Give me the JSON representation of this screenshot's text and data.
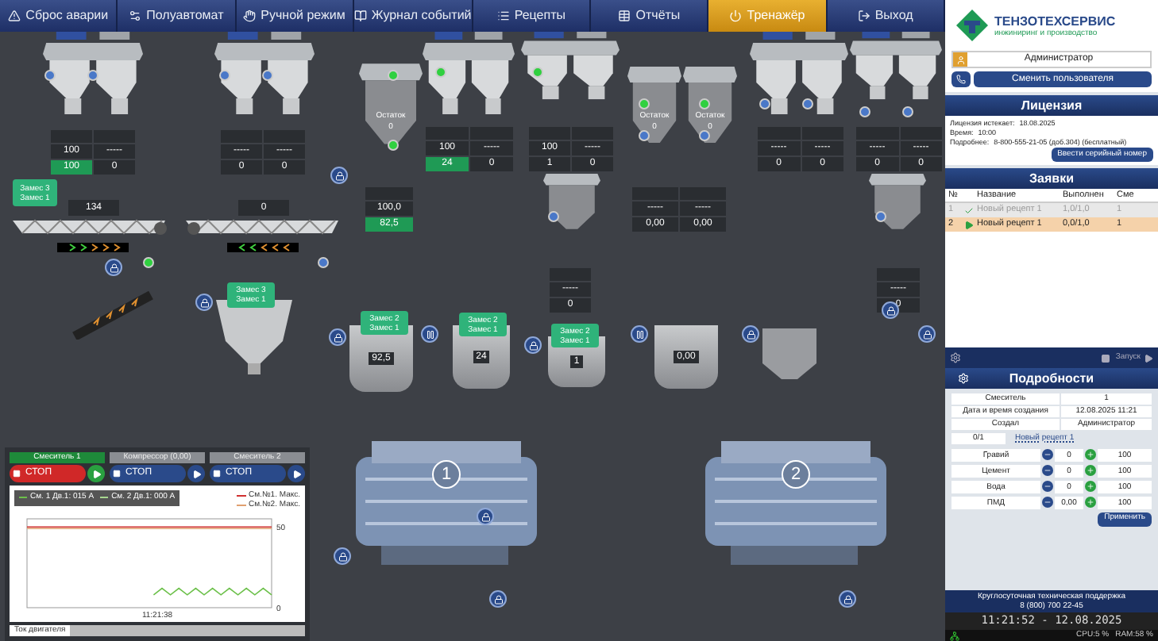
{
  "menu": [
    {
      "label": "Сброс аварии",
      "selected": false
    },
    {
      "label": "Полуавтомат",
      "selected": false
    },
    {
      "label": "Ручной режим",
      "selected": false
    },
    {
      "label": "Журнал событий",
      "selected": false
    },
    {
      "label": "Рецепты",
      "selected": false
    },
    {
      "label": "Отчёты",
      "selected": false
    },
    {
      "label": "Тренажёр",
      "selected": true
    },
    {
      "label": "Выход",
      "selected": false
    }
  ],
  "canvas": {
    "readouts": [
      {
        "rows": [
          [
            {
              "text": "100",
              "active": false
            },
            {
              "text": "-----",
              "active": false
            }
          ],
          [
            {
              "text": "100",
              "active": true
            },
            {
              "text": "0",
              "active": false
            }
          ]
        ]
      },
      {
        "rows": [
          [
            {
              "text": "-----",
              "active": false
            },
            {
              "text": "-----",
              "active": false
            }
          ],
          [
            {
              "text": "0",
              "active": false
            },
            {
              "text": "0",
              "active": false
            }
          ]
        ]
      },
      {
        "rows": [
          [
            {
              "text": "100",
              "active": false
            },
            {
              "text": "-----",
              "active": false
            }
          ],
          [
            {
              "text": "24",
              "active": true
            },
            {
              "text": "0",
              "active": false
            }
          ]
        ]
      },
      {
        "rows": [
          [
            {
              "text": "100",
              "active": false
            },
            {
              "text": "-----",
              "active": false
            }
          ],
          [
            {
              "text": "1",
              "active": false
            },
            {
              "text": "0",
              "active": false
            }
          ]
        ]
      },
      {
        "rows": [
          [
            {
              "text": "-----",
              "active": false
            },
            {
              "text": "-----",
              "active": false
            }
          ],
          [
            {
              "text": "0,00",
              "active": false
            },
            {
              "text": "0,00",
              "active": false
            }
          ]
        ]
      },
      {
        "rows": [
          [
            {
              "text": "-----",
              "active": false
            },
            {
              "text": "-----",
              "active": false
            }
          ],
          [
            {
              "text": "0",
              "active": false
            },
            {
              "text": "0",
              "active": false
            }
          ]
        ]
      },
      {
        "rows": [
          [
            {
              "text": "-----",
              "active": false
            },
            {
              "text": "-----",
              "active": false
            }
          ],
          [
            {
              "text": "0",
              "active": false
            },
            {
              "text": "0",
              "active": false
            }
          ]
        ]
      },
      {
        "rows": [
          [
            {
              "text": "-----",
              "active": false
            }
          ],
          [
            {
              "text": "0",
              "active": false
            }
          ]
        ]
      },
      {
        "rows": [
          [
            {
              "text": "-----",
              "active": false
            }
          ],
          [
            {
              "text": "0",
              "active": false
            }
          ]
        ]
      },
      {
        "rows": [
          [
            {
              "text": "100,0",
              "active": false
            }
          ],
          [
            {
              "text": "82,5",
              "active": true
            }
          ]
        ]
      }
    ],
    "remainders": [
      {
        "label": "Остаток",
        "value": "0"
      },
      {
        "label": "Остаток",
        "value": "0"
      },
      {
        "label": "Остаток",
        "value": "0"
      }
    ],
    "conveyors": [
      {
        "reading": "134",
        "reversed": false
      },
      {
        "reading": "0",
        "reversed": true
      }
    ],
    "tags": [
      {
        "lines": [
          "Замес 3",
          "Замес 1"
        ]
      },
      {
        "lines": [
          "Замес 3",
          "Замес 1"
        ]
      },
      {
        "lines": [
          "Замес 2",
          "Замес 1"
        ]
      },
      {
        "lines": [
          "Замес 2",
          "Замес 1"
        ]
      },
      {
        "lines": [
          "Замес 2",
          "Замес 1"
        ]
      }
    ],
    "weighers": [
      {
        "reading": "92,5"
      },
      {
        "reading": "24"
      },
      {
        "reading": "1"
      },
      {
        "reading": "0,00"
      }
    ],
    "mixers": [
      {
        "number": "1"
      },
      {
        "number": "2"
      }
    ]
  },
  "mixer_panel": {
    "units": [
      {
        "name": "Смеситель 1",
        "running": true,
        "stop_label": "СТОП"
      },
      {
        "name": "Компрессор (0,00)",
        "running": false,
        "stop_label": "СТОП"
      },
      {
        "name": "Смеситель 2",
        "running": false,
        "stop_label": "СТОП"
      }
    ],
    "chart_data": {
      "type": "line",
      "ylim": [
        0,
        55
      ],
      "yticks": [
        {
          "value": 0,
          "label": "0"
        },
        {
          "value": 50,
          "label": "50"
        }
      ],
      "series": [
        {
          "name": "См. 1 Дв.1: 015 А",
          "color": "#6cc04a",
          "values": [
            null,
            null,
            null,
            null,
            null,
            null,
            null,
            null,
            null,
            null,
            null,
            null,
            null,
            null,
            null,
            8,
            12,
            8,
            12,
            8,
            12,
            8,
            12,
            8,
            12,
            8,
            12,
            8,
            12,
            8
          ]
        },
        {
          "name": "См. 2 Дв.1: 000 А",
          "color": "#a8d890",
          "values": [
            null,
            null,
            null,
            null,
            null,
            null,
            null,
            null,
            null,
            null,
            null,
            null,
            null,
            null,
            null,
            null,
            null,
            null,
            null,
            null,
            null,
            null,
            null,
            null,
            null,
            null,
            null,
            null,
            null,
            null
          ]
        },
        {
          "name": "См.№1. Макс.",
          "color": "#d03030",
          "values": [
            50,
            50,
            50,
            50,
            50,
            50,
            50,
            50,
            50,
            50,
            50,
            50,
            50,
            50,
            50,
            50,
            50,
            50,
            50,
            50,
            50,
            50,
            50,
            50,
            50,
            50,
            50,
            50,
            50,
            50
          ]
        },
        {
          "name": "См.№2. Макс.",
          "color": "#e0a070",
          "values": [
            49,
            49,
            49,
            49,
            49,
            49,
            49,
            49,
            49,
            49,
            49,
            49,
            49,
            49,
            49,
            49,
            49,
            49,
            49,
            49,
            49,
            49,
            49,
            49,
            49,
            49,
            49,
            49,
            49,
            49
          ]
        }
      ]
    },
    "time_label": "11:21:38",
    "tab": "Ток двигателя"
  },
  "sidebar": {
    "logo": {
      "name": "ТЕНЗОТЕХСЕРВИС",
      "tagline": "инжиниринг и производство"
    },
    "user": {
      "name": "Администратор",
      "button": "Сменить пользователя"
    },
    "license": {
      "title": "Лицензия",
      "lines": [
        {
          "label": "Лицензия истекает:",
          "value": "18.08.2025"
        },
        {
          "label": "Время:",
          "value": "10:00"
        },
        {
          "label": "Подробнее:",
          "value": "8-800-555-21-05 (доб.304) (бесплатный)"
        }
      ],
      "button": "Ввести серийный номер"
    },
    "orders": {
      "title": "Заявки",
      "columns": [
        "№",
        "Название",
        "Выполнен",
        "Сме"
      ],
      "rows": [
        {
          "no": "1",
          "name": "Новый рецепт 1",
          "done": "1,0/1,0",
          "mixer": "1",
          "completed": true,
          "selected": false
        },
        {
          "no": "2",
          "name": "Новый рецепт 1",
          "done": "0,0/1,0",
          "mixer": "1",
          "completed": false,
          "selected": true
        }
      ],
      "start": "Запуск"
    },
    "details": {
      "title": "Подробности",
      "info": [
        {
          "label": "Смеситель",
          "value": "1"
        },
        {
          "label": "Дата и время создания",
          "value": "12.08.2025 11:21"
        },
        {
          "label": "Создал",
          "value": "Администратор"
        }
      ],
      "batch": "0/1",
      "recipe": "Новый рецепт 1",
      "ingredients": [
        {
          "name": "Гравий",
          "amount": "0",
          "total": "100"
        },
        {
          "name": "Цемент",
          "amount": "0",
          "total": "100"
        },
        {
          "name": "Вода",
          "amount": "0",
          "total": "100"
        },
        {
          "name": "ПМД",
          "amount": "0,00",
          "total": "100"
        }
      ],
      "apply": "Применить"
    },
    "support": {
      "text": "Круглосуточная техническая поддержка",
      "phone": "8 (800) 700 22-45"
    },
    "status_bar": {
      "clock": "11:21:52 - 12.08.2025",
      "cpu": "CPU:5 %",
      "ram": "RAM:58 %"
    }
  }
}
